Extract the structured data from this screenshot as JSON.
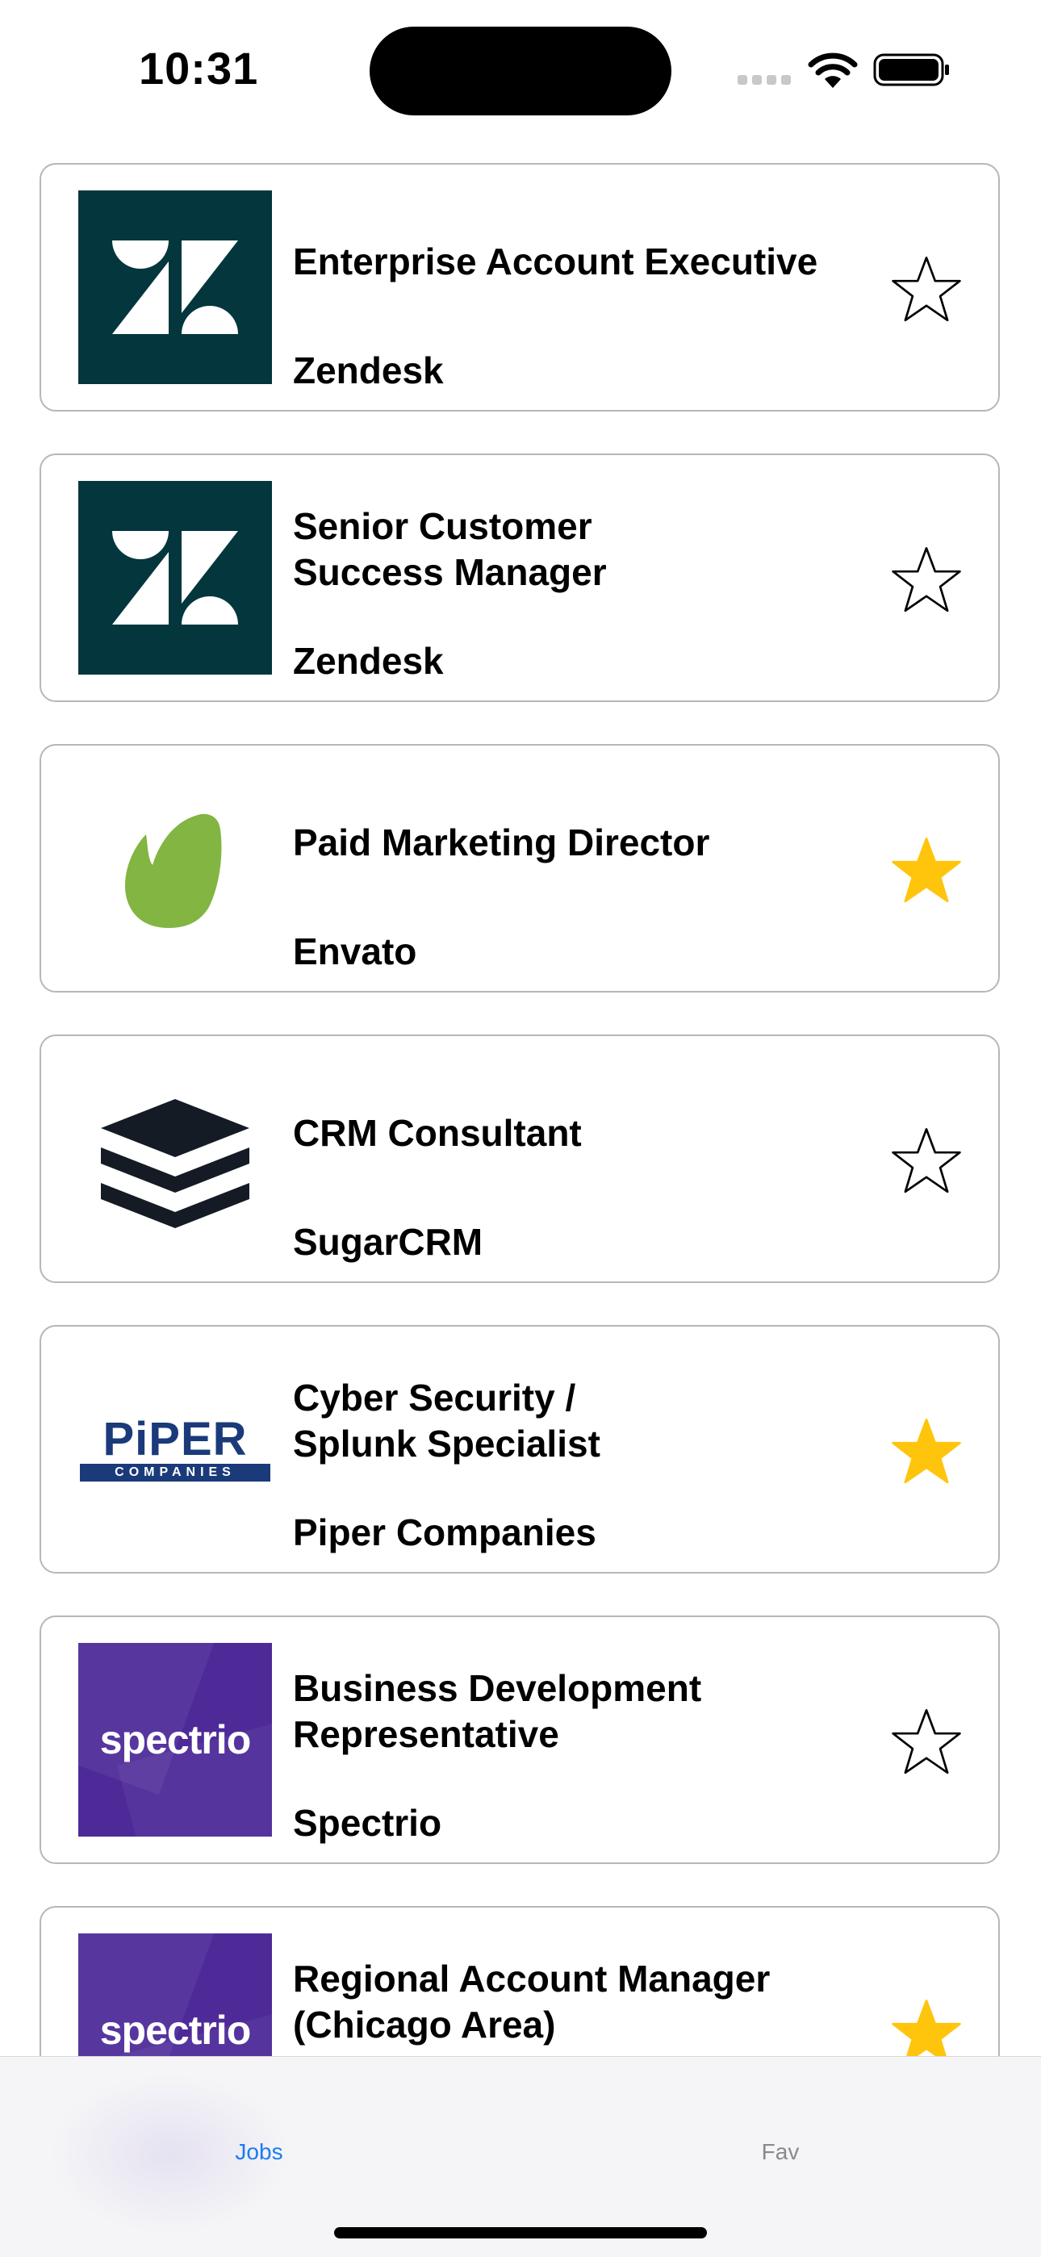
{
  "status_bar": {
    "time": "10:31"
  },
  "jobs": [
    {
      "title": "Enterprise Account Executive",
      "company": "Zendesk",
      "logo": "zendesk-logo",
      "favorite": false
    },
    {
      "title": "Senior Customer\nSuccess Manager",
      "company": "Zendesk",
      "logo": "zendesk-logo",
      "favorite": false
    },
    {
      "title": "Paid Marketing Director",
      "company": "Envato",
      "logo": "envato-logo",
      "favorite": true
    },
    {
      "title": "CRM Consultant",
      "company": "SugarCRM",
      "logo": "sugarcrm-logo",
      "favorite": false
    },
    {
      "title": "Cyber Security /\nSplunk Specialist",
      "company": "Piper Companies",
      "logo": "piper-logo",
      "favorite": true
    },
    {
      "title": "Business Development\nRepresentative",
      "company": "Spectrio",
      "logo": "spectrio-logo",
      "favorite": false
    },
    {
      "title": "Regional Account Manager\n(Chicago Area)",
      "company": "",
      "logo": "spectrio-logo",
      "favorite": true
    }
  ],
  "logos": {
    "piper_main": "PiPER",
    "piper_sub": "COMPANIES",
    "spectrio": "spectrio"
  },
  "tab_bar": {
    "tabs": [
      {
        "label": "Jobs",
        "active": true
      },
      {
        "label": "Fav",
        "active": false
      }
    ]
  },
  "colors": {
    "accent": "#1a7cf0",
    "star_filled": "#ffc40c",
    "zendesk_bg": "#03363d",
    "envato_green": "#82b541",
    "sugarcrm_dark": "#141b25",
    "piper_navy": "#1a3a7a",
    "piper_red": "#d62027",
    "spectrio_purple": "#4d2a98"
  }
}
